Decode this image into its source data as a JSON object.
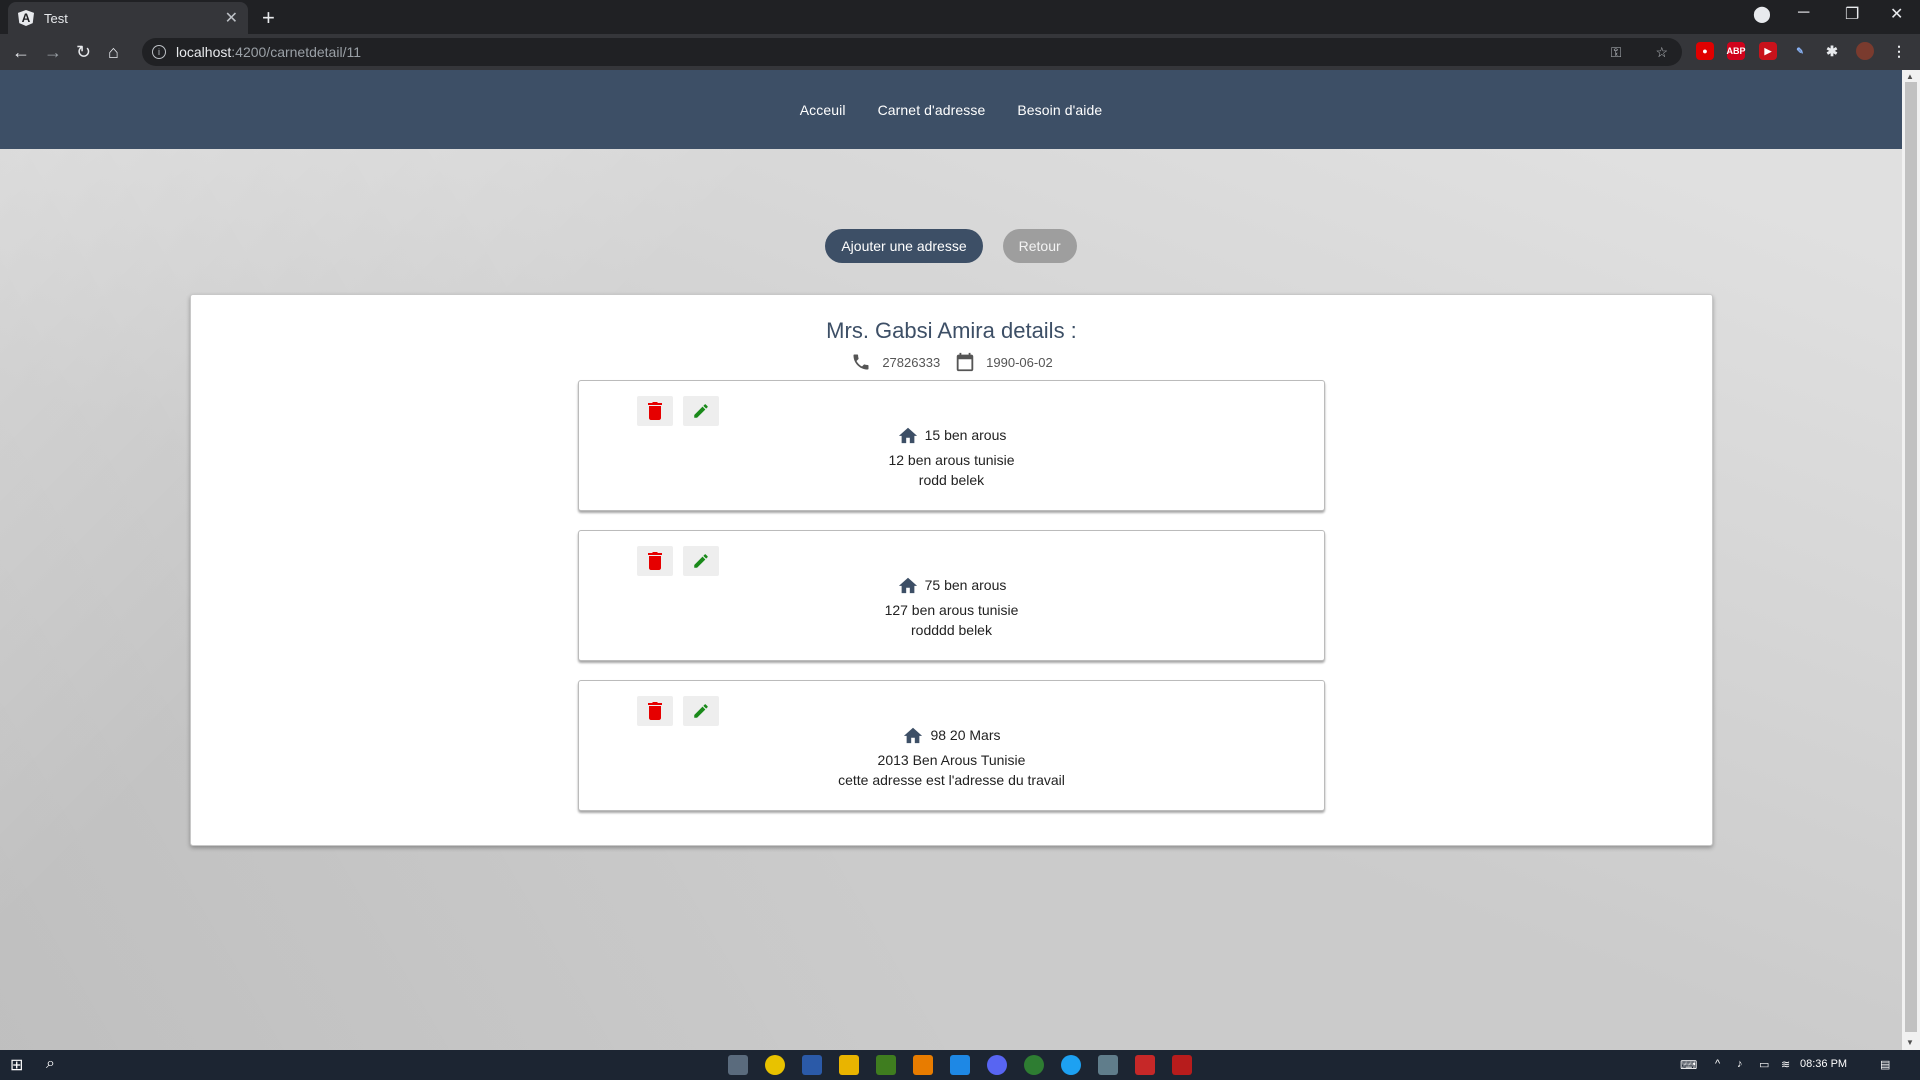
{
  "browser": {
    "tab_title": "Test",
    "tab_favicon_letter": "A",
    "url_host": "localhost",
    "url_path": ":4200/carnetdetail/11"
  },
  "nav": {
    "items": [
      "Acceuil",
      "Carnet d'adresse",
      "Besoin d'aide"
    ]
  },
  "actions": {
    "add_label": "Ajouter une adresse",
    "back_label": "Retour"
  },
  "details": {
    "title": "Mrs. Gabsi Amira details :",
    "phone": "27826333",
    "birthdate": "1990-06-02"
  },
  "addresses": [
    {
      "line1": "15 ben arous",
      "line2": "12 ben arous tunisie",
      "line3": "rodd belek"
    },
    {
      "line1": "75 ben arous",
      "line2": "127 ben arous tunisie",
      "line3": "rodddd belek"
    },
    {
      "line1": "98 20 Mars",
      "line2": "2013 Ben Arous Tunisie",
      "line3": "cette adresse est l'adresse du travail"
    }
  ],
  "taskbar": {
    "time": "08:36 PM"
  },
  "colors": {
    "nav_bg": "#3d4f66",
    "delete": "#e60000",
    "edit": "#1a8a1a"
  }
}
